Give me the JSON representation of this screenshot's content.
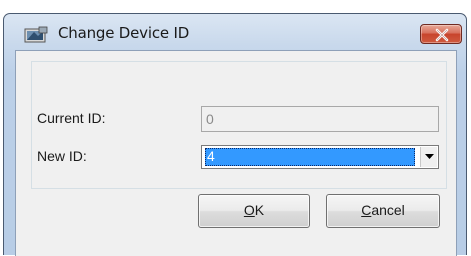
{
  "window": {
    "title": "Change Device ID",
    "icon": "device-app-icon",
    "close_icon": "close-icon"
  },
  "form": {
    "current_id_label": "Current ID:",
    "current_id_value": "0",
    "new_id_label": "New ID:",
    "new_id_value": "4"
  },
  "buttons": {
    "ok_mnemonic": "O",
    "ok_rest": "K",
    "cancel_mnemonic": "C",
    "cancel_rest": "ancel"
  },
  "colors": {
    "selection": "#3399ff",
    "close_button": "#c8442c"
  }
}
